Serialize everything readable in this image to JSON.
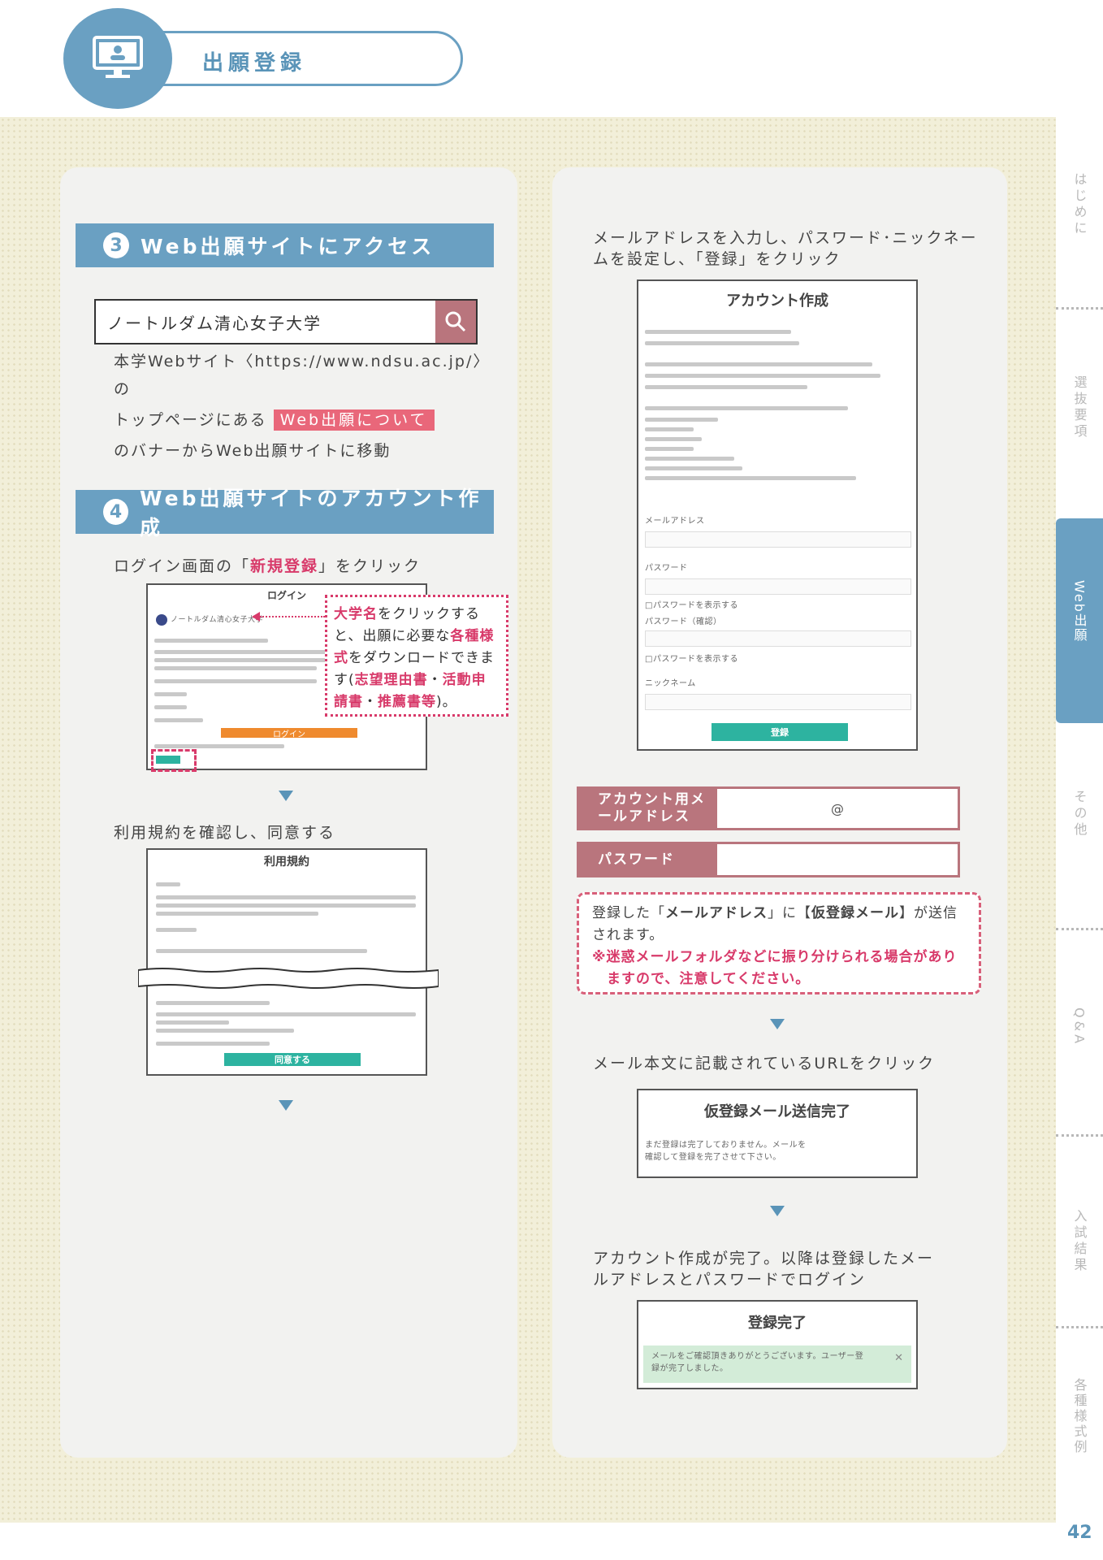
{
  "header": {
    "title": "出願登録",
    "icon": "computer-monitor-icon"
  },
  "section3": {
    "number": "3",
    "title": "Web出願サイトにアクセス",
    "search_text": "ノートルダム清心女子大学",
    "line1": "本学Webサイト〈https://www.ndsu.ac.jp/〉の",
    "line2_pre": "トップページにある",
    "line2_highlight": "Web出願について",
    "line3": "のバナーからWeb出願サイトに移動"
  },
  "section4": {
    "number": "4",
    "title": "Web出願サイトのアカウント作成",
    "step1_pre": "ログイン画面の「",
    "step1_bold": "新規登録",
    "step1_post": "」をクリック",
    "login_title": "ログイン",
    "login_univ": "ノートルダム清心女子大学",
    "login_button": "ログイン",
    "callout_parts": [
      "大学名",
      "をクリックすると、出願に必要な",
      "各種様式",
      "をダウンロードできます(",
      "志望理由書",
      "・",
      "活動申請書",
      "・",
      "推薦書等",
      ")。"
    ],
    "step2": "利用規約を確認し、同意する",
    "terms_title": "利用規約",
    "terms_button": "同意する"
  },
  "right": {
    "step1": "メールアドレスを入力し、パスワード･ニックネームを設定し、「登録」をクリック",
    "account_title": "アカウント作成",
    "form_fields": [
      "メールアドレス",
      "パスワード",
      "□パスワードを表示する",
      "パスワード（確認）",
      "□パスワードを表示する",
      "ニックネーム"
    ],
    "register_button": "登録",
    "email_label": "アカウント用メールアドレス",
    "email_at": "@",
    "password_label": "パスワード",
    "notice_pre": "登録した「",
    "notice_bold1": "メールアドレス",
    "notice_mid": "」に【",
    "notice_bold2": "仮登録メール",
    "notice_post": "】が送信されます。",
    "notice_warning": "※迷惑メールフォルダなどに振り分けられる場合がありますので、注意してください。",
    "step2": "メール本文に記載されているURLをクリック",
    "temp_title": "仮登録メール送信完了",
    "temp_body": "まだ登録は完了しておりません。メールを確認して登録を完了させて下さい。",
    "step3": "アカウント作成が完了。以降は登録したメールアドレスとパスワードでログイン",
    "done_title": "登録完了",
    "done_body": "メールをご確認頂きありがとうございます。ユーザー登録が完了しました。"
  },
  "tabs": [
    "はじめに",
    "選抜要項",
    "Web出願",
    "その他",
    "Q&A",
    "入試結果",
    "各種様式例"
  ],
  "page_number": "42"
}
